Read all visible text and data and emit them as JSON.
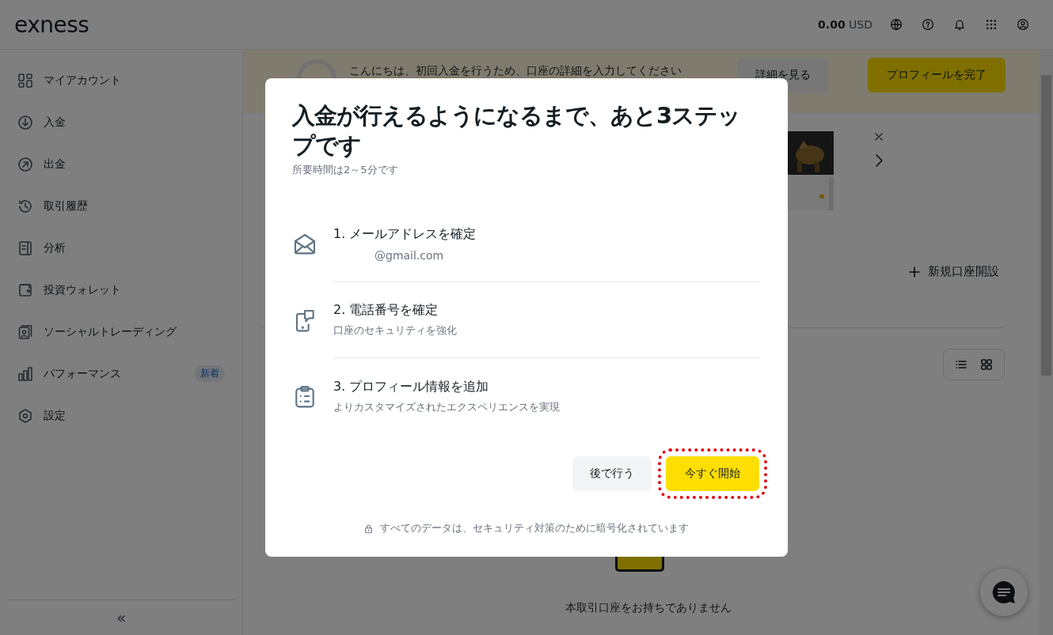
{
  "header": {
    "logo": "exness",
    "balance_amount": "0.00",
    "balance_currency": "USD"
  },
  "sidebar": {
    "items": [
      {
        "label": "マイアカウント"
      },
      {
        "label": "入金"
      },
      {
        "label": "出金"
      },
      {
        "label": "取引履歴"
      },
      {
        "label": "分析"
      },
      {
        "label": "投資ウォレット"
      },
      {
        "label": "ソーシャルトレーディング"
      },
      {
        "label": "パフォーマンス",
        "badge": "新着"
      },
      {
        "label": "設定"
      }
    ],
    "collapse": "«"
  },
  "banner": {
    "text": "こんにちは、初回入金を行うため、口座の詳細を入力してください",
    "details_button": "詳細を見る",
    "complete_button": "プロフィールを完了"
  },
  "accounts": {
    "new_account_button": "新規口座開設",
    "empty_text": "本取引口座をお持ちでありません"
  },
  "modal": {
    "title": "入金が行えるようになるまで、あと3ステップです",
    "subtitle": "所要時間は2～5分です",
    "steps": [
      {
        "title": "1. メールアドレスを確定",
        "detail": "@gmail.com",
        "indented": true
      },
      {
        "title": "2. 電話番号を確定",
        "detail": "口座のセキュリティを強化",
        "indented": false
      },
      {
        "title": "3. プロフィール情報を追加",
        "detail": "よりカスタマイズされたエクスペリエンスを実現",
        "indented": false
      }
    ],
    "later_button": "後で行う",
    "start_button": "今すぐ開始",
    "start_highlighted": true,
    "footer": "すべてのデータは、セキュリティ対策のために暗号化されています"
  }
}
